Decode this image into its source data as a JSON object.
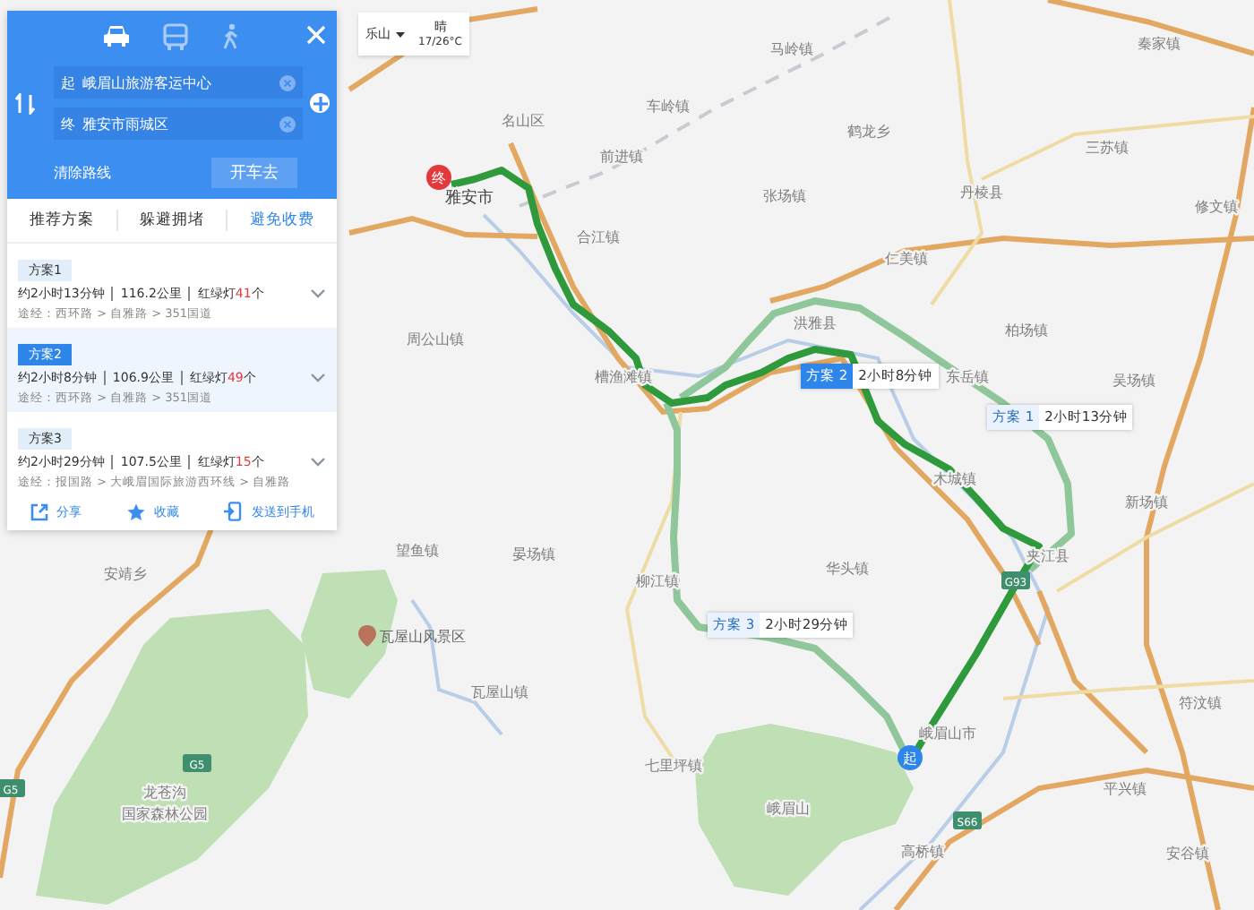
{
  "modes": [
    {
      "kind": "car",
      "selected": true
    },
    {
      "kind": "bus",
      "selected": false
    },
    {
      "kind": "walk",
      "selected": false
    }
  ],
  "route_inputs": [
    {
      "marker": "起",
      "value": "峨眉山旅游客运中心"
    },
    {
      "marker": "终",
      "value": "雅安市雨城区"
    }
  ],
  "clear_route": "清除路线",
  "go_button": "开车去",
  "tabs": [
    {
      "label": "推荐方案",
      "selected": false
    },
    {
      "label": "躲避拥堵",
      "selected": false
    },
    {
      "label": "避免收费",
      "selected": true
    }
  ],
  "plans": [
    {
      "tag": "方案1",
      "selected": false,
      "duration": "约2小时13分钟",
      "distance": "116.2公里",
      "lights_label": "红绿灯",
      "lights_count": "41",
      "lights_unit": "个",
      "via": "途经：西环路 > 自雅路 > 351国道"
    },
    {
      "tag": "方案2",
      "selected": true,
      "duration": "约2小时8分钟",
      "distance": "106.9公里",
      "lights_label": "红绿灯",
      "lights_count": "49",
      "lights_unit": "个",
      "via": "途经：西环路 > 自雅路 > 351国道"
    },
    {
      "tag": "方案3",
      "selected": false,
      "duration": "约2小时29分钟",
      "distance": "107.5公里",
      "lights_label": "红绿灯",
      "lights_count": "15",
      "lights_unit": "个",
      "via": "途经：报国路 > 大峨眉国际旅游西环线 > 自雅路"
    }
  ],
  "actions": [
    {
      "kind": "share",
      "label": "分享"
    },
    {
      "kind": "star",
      "label": "收藏"
    },
    {
      "kind": "phone",
      "label": "发送到手机"
    }
  ],
  "weather": {
    "city": "乐山",
    "condition": "晴",
    "temperature": "17/26°C"
  },
  "map": {
    "places": [
      "马岭镇",
      "秦家镇",
      "车岭镇",
      "名山区",
      "前进镇",
      "鹤龙乡",
      "三苏镇",
      "张场镇",
      "丹棱县",
      "修文镇",
      "合江镇",
      "仁美镇",
      "洪雅县",
      "柏场镇",
      "周公山镇",
      "槽渔滩镇",
      "东岳镇",
      "吴场镇",
      "木城镇",
      "新场镇",
      "望鱼镇",
      "晏场镇",
      "柳江镇",
      "华头镇",
      "夹江县",
      "安靖乡",
      "瓦屋山镇",
      "七里坪镇",
      "峨眉山",
      "峨眉山市",
      "高桥镇",
      "平兴镇",
      "符汶镇",
      "安谷镇"
    ],
    "city_label": "雅安市",
    "scenic_spot": "瓦屋山风景区",
    "park_label": [
      "龙苍沟",
      "国家森林公园"
    ],
    "shields": [
      "G5",
      "G5",
      "G93",
      "S66"
    ],
    "route_callouts": [
      {
        "tag": "方案 2",
        "time": "2小时8分钟",
        "selected": true
      },
      {
        "tag": "方案 1",
        "time": "2小时13分钟",
        "selected": false
      },
      {
        "tag": "方案 3",
        "time": "2小时29分钟",
        "selected": false
      }
    ],
    "start_marker": "起",
    "end_marker": "终"
  }
}
